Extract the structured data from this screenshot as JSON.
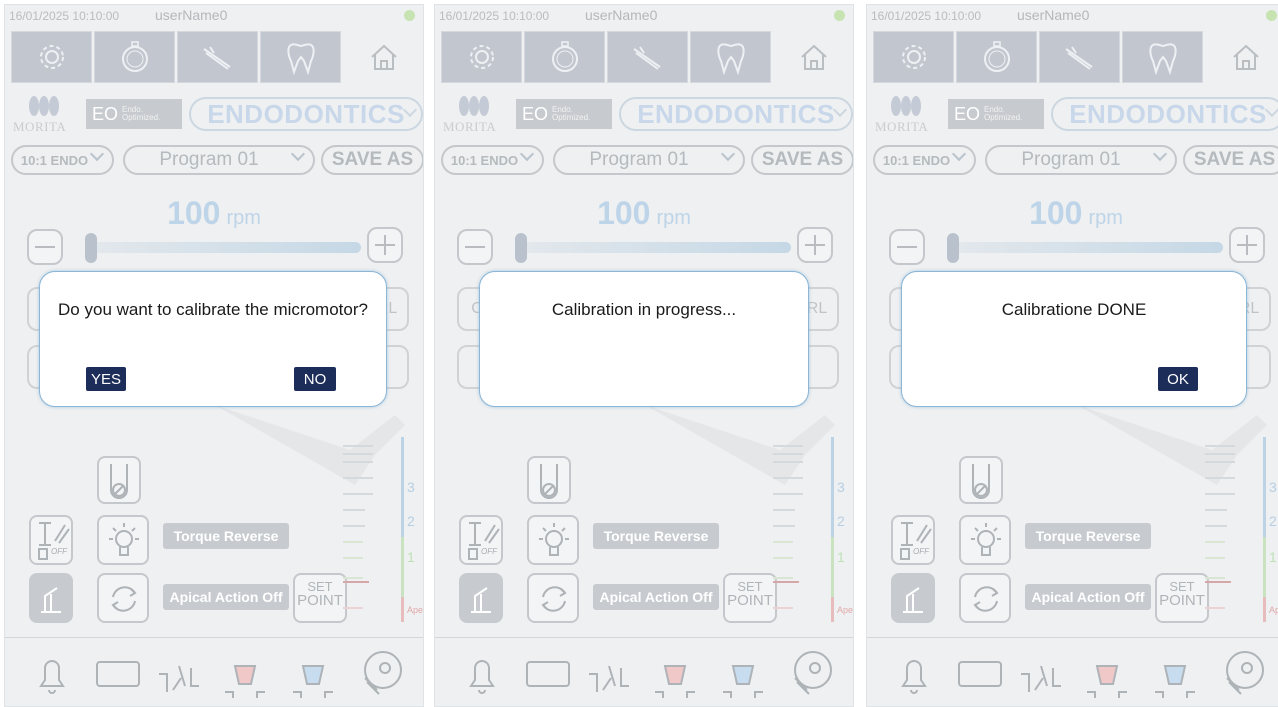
{
  "status": {
    "datetime": "16/01/2025 10:10:00",
    "user": "userName0"
  },
  "brand": {
    "logo_text": "MORITA",
    "eo_label": "EO",
    "eo_small_1": "Endo.",
    "eo_small_2": "Optimized.",
    "mode": "ENDODONTICS"
  },
  "program": {
    "handpiece": "10:1 ENDO",
    "name": "Program 01",
    "save_as": "SAVE AS"
  },
  "speed": {
    "value": "100",
    "unit": "rpm"
  },
  "controls": {
    "torque_reverse": "Torque Reverse",
    "apical_action": "Apical Action Off",
    "set_point_1": "SET",
    "set_point_2": "POINT",
    "off": "OFF",
    "ghost_left": "C",
    "ghost_right": "RL"
  },
  "scale": {
    "labels": [
      "3",
      "2",
      "1"
    ],
    "apex": "Apex"
  },
  "dialogs": {
    "confirm": {
      "message": "Do you want to calibrate the micromotor?",
      "yes": "YES",
      "no": "NO"
    },
    "progress": {
      "message": "Calibration in progress..."
    },
    "done": {
      "message": "Calibratione DONE",
      "ok": "OK"
    }
  },
  "colors": {
    "dialog_button": "#1c2d59",
    "dialog_border": "#8bb6d6",
    "status_led": "#c7e3b2"
  }
}
